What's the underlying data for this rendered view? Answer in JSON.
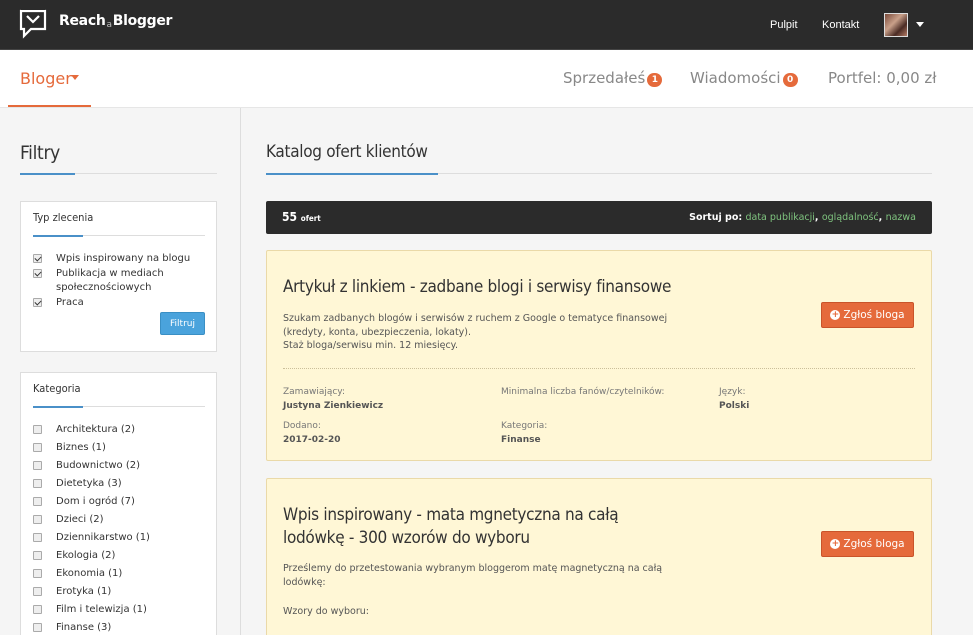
{
  "topbar": {
    "brand_left": "Reach",
    "brand_mid": "a",
    "brand_right": "Blogger",
    "nav": [
      "Pulpit",
      "Kontakt"
    ]
  },
  "subheader": {
    "role": "Bloger",
    "sold_label": "Sprzedałeś",
    "sold_count": "1",
    "messages_label": "Wiadomości",
    "messages_count": "0",
    "wallet_label": "Portfel: 0,00 zł"
  },
  "sidebar": {
    "title": "Filtry",
    "type_panel": {
      "title": "Typ zlecenia",
      "items": [
        {
          "label": "Wpis inspirowany na blogu",
          "checked": true
        },
        {
          "label": "Publikacja w mediach społecznościowych",
          "checked": true
        },
        {
          "label": "Praca",
          "checked": true
        }
      ],
      "button": "Filtruj"
    },
    "category_panel": {
      "title": "Kategoria",
      "items": [
        "Architektura (2)",
        "Biznes (1)",
        "Budownictwo (2)",
        "Dietetyka (3)",
        "Dom i ogród (7)",
        "Dzieci (2)",
        "Dziennikarstwo (1)",
        "Ekologia (2)",
        "Ekonomia (1)",
        "Erotyka (1)",
        "Film i telewizja (1)",
        "Finanse (3)"
      ]
    }
  },
  "main": {
    "title": "Katalog ofert klientów",
    "count": "55",
    "count_suffix": "ofert",
    "sort_label": "Sortuj po:",
    "sort_options": [
      "data publikacji",
      "oglądalność",
      "nazwa"
    ],
    "offers": [
      {
        "title": "Artykuł z linkiem - zadbane blogi i serwisy finansowe",
        "desc_1": "Szukam zadbanych blogów i serwisów z ruchem z Google o tematyce finansowej (kredyty, konta, ubezpieczenia, lokaty).",
        "desc_2": "Staż bloga/serwisu min. 12 miesięcy.",
        "button": "Zgłoś bloga",
        "client_label": "Zamawiający:",
        "client": "Justyna Zienkiewicz",
        "min_fans_label": "Minimalna liczba fanów/czytelników:",
        "language_label": "Język:",
        "language": "Polski",
        "added_label": "Dodano:",
        "added": "2017-02-20",
        "category_label": "Kategoria:",
        "category": "Finanse"
      },
      {
        "title": "Wpis inspirowany - mata mgnetyczna na całą lodówkę - 300 wzorów do wyboru",
        "desc_1": "Prześlemy do przetestowania wybranym bloggerom matę magnetyczną na całą lodówkę:",
        "desc_2": "Wzory do wyboru:",
        "button": "Zgłoś bloga"
      }
    ]
  }
}
